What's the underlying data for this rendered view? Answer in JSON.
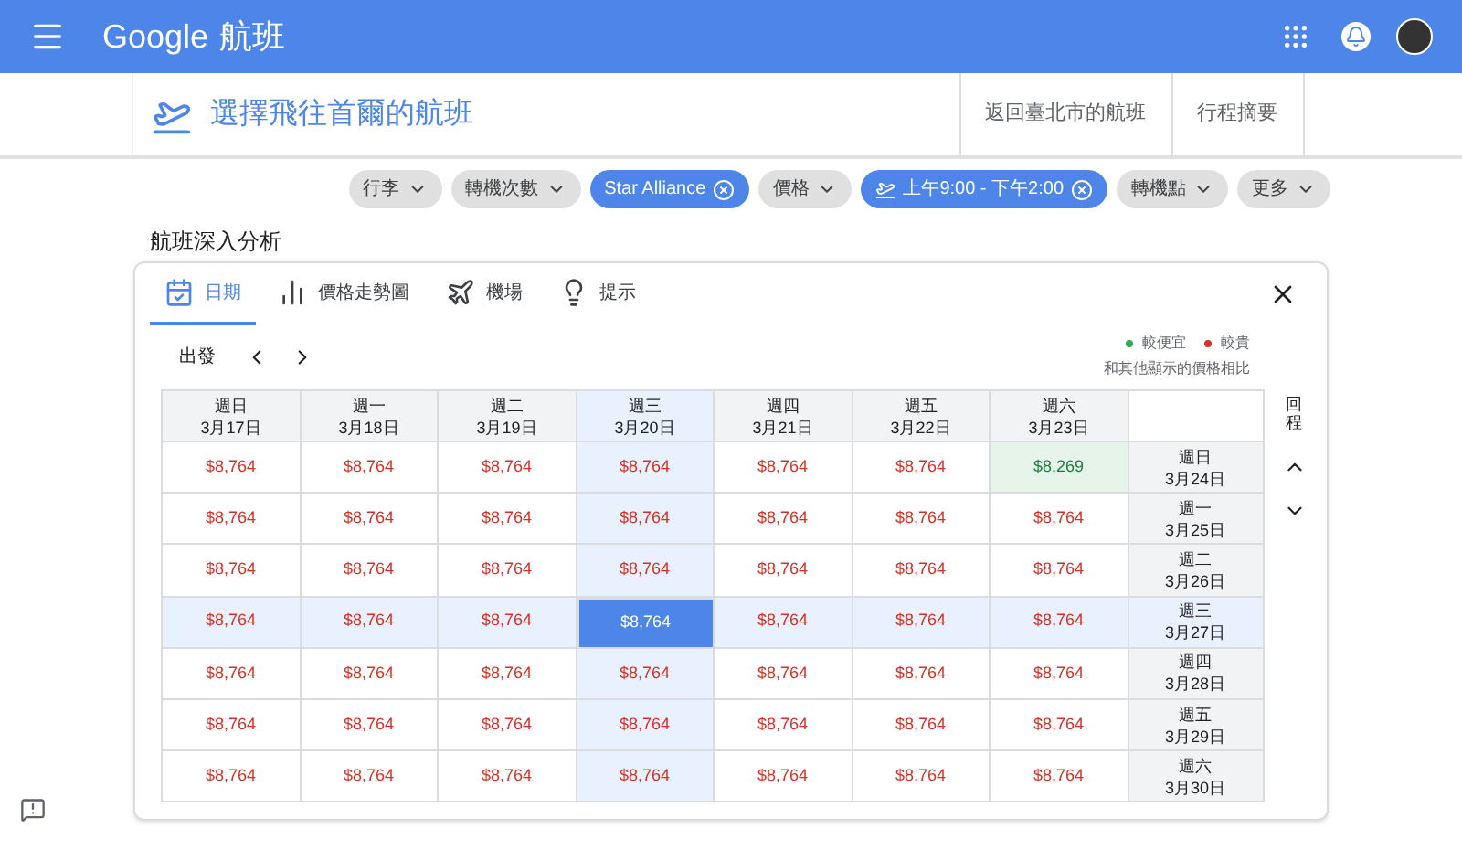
{
  "app_bar": {
    "brand": "Google",
    "product": "航班"
  },
  "trip_header": {
    "title": "選擇飛往首爾的航班",
    "steps": [
      {
        "label": "返回臺北市的航班"
      },
      {
        "label": "行程摘要"
      }
    ]
  },
  "filters": [
    {
      "label": "行李",
      "active": false,
      "kind": "plain"
    },
    {
      "label": "轉機次數",
      "active": false,
      "kind": "plain"
    },
    {
      "label": "Star Alliance",
      "active": true,
      "kind": "plain"
    },
    {
      "label": "價格",
      "active": false,
      "kind": "plain"
    },
    {
      "label": "上午9:00 - 下午2:00",
      "active": true,
      "kind": "takeoff"
    },
    {
      "label": "轉機點",
      "active": false,
      "kind": "plain"
    },
    {
      "label": "更多",
      "active": false,
      "kind": "plain"
    }
  ],
  "section_title": "航班深入分析",
  "tabs": [
    {
      "label": "日期",
      "kind": "calendar",
      "selected": true
    },
    {
      "label": "價格走勢圖",
      "kind": "chart",
      "selected": false
    },
    {
      "label": "機場",
      "kind": "plane",
      "selected": false
    },
    {
      "label": "提示",
      "kind": "bulb",
      "selected": false
    }
  ],
  "date_grid": {
    "departure_label": "出發",
    "return_label": "回程",
    "legend": [
      {
        "label": "較便宜",
        "color": "#34a853"
      },
      {
        "label": "較貴",
        "color": "#d93025"
      }
    ],
    "legend_note": "和其他顯示的價格相比",
    "columns": [
      {
        "day": "週日",
        "date": "3月17日"
      },
      {
        "day": "週一",
        "date": "3月18日"
      },
      {
        "day": "週二",
        "date": "3月19日"
      },
      {
        "day": "週三",
        "date": "3月20日"
      },
      {
        "day": "週四",
        "date": "3月21日"
      },
      {
        "day": "週五",
        "date": "3月22日"
      },
      {
        "day": "週六",
        "date": "3月23日"
      }
    ],
    "rows": [
      {
        "day": "週日",
        "date": "3月24日",
        "cells": [
          {
            "price": "$8,764",
            "kind": "expensive",
            "selected": false
          },
          {
            "price": "$8,764",
            "kind": "expensive",
            "selected": false
          },
          {
            "price": "$8,764",
            "kind": "expensive",
            "selected": false
          },
          {
            "price": "$8,764",
            "kind": "expensive",
            "selected": false
          },
          {
            "price": "$8,764",
            "kind": "expensive",
            "selected": false
          },
          {
            "price": "$8,764",
            "kind": "expensive",
            "selected": false
          },
          {
            "price": "$8,269",
            "kind": "cheaper",
            "selected": false
          }
        ]
      },
      {
        "day": "週一",
        "date": "3月25日",
        "cells": [
          {
            "price": "$8,764",
            "kind": "expensive",
            "selected": false
          },
          {
            "price": "$8,764",
            "kind": "expensive",
            "selected": false
          },
          {
            "price": "$8,764",
            "kind": "expensive",
            "selected": false
          },
          {
            "price": "$8,764",
            "kind": "expensive",
            "selected": false
          },
          {
            "price": "$8,764",
            "kind": "expensive",
            "selected": false
          },
          {
            "price": "$8,764",
            "kind": "expensive",
            "selected": false
          },
          {
            "price": "$8,764",
            "kind": "expensive",
            "selected": false
          }
        ]
      },
      {
        "day": "週二",
        "date": "3月26日",
        "cells": [
          {
            "price": "$8,764",
            "kind": "expensive",
            "selected": false
          },
          {
            "price": "$8,764",
            "kind": "expensive",
            "selected": false
          },
          {
            "price": "$8,764",
            "kind": "expensive",
            "selected": false
          },
          {
            "price": "$8,764",
            "kind": "expensive",
            "selected": false
          },
          {
            "price": "$8,764",
            "kind": "expensive",
            "selected": false
          },
          {
            "price": "$8,764",
            "kind": "expensive",
            "selected": false
          },
          {
            "price": "$8,764",
            "kind": "expensive",
            "selected": false
          }
        ]
      },
      {
        "day": "週三",
        "date": "3月27日",
        "cells": [
          {
            "price": "$8,764",
            "kind": "expensive",
            "selected": false
          },
          {
            "price": "$8,764",
            "kind": "expensive",
            "selected": false
          },
          {
            "price": "$8,764",
            "kind": "expensive",
            "selected": false
          },
          {
            "price": "$8,764",
            "kind": "expensive",
            "selected": true
          },
          {
            "price": "$8,764",
            "kind": "expensive",
            "selected": false
          },
          {
            "price": "$8,764",
            "kind": "expensive",
            "selected": false
          },
          {
            "price": "$8,764",
            "kind": "expensive",
            "selected": false
          }
        ]
      },
      {
        "day": "週四",
        "date": "3月28日",
        "cells": [
          {
            "price": "$8,764",
            "kind": "expensive",
            "selected": false
          },
          {
            "price": "$8,764",
            "kind": "expensive",
            "selected": false
          },
          {
            "price": "$8,764",
            "kind": "expensive",
            "selected": false
          },
          {
            "price": "$8,764",
            "kind": "expensive",
            "selected": false
          },
          {
            "price": "$8,764",
            "kind": "expensive",
            "selected": false
          },
          {
            "price": "$8,764",
            "kind": "expensive",
            "selected": false
          },
          {
            "price": "$8,764",
            "kind": "expensive",
            "selected": false
          }
        ]
      },
      {
        "day": "週五",
        "date": "3月29日",
        "cells": [
          {
            "price": "$8,764",
            "kind": "expensive",
            "selected": false
          },
          {
            "price": "$8,764",
            "kind": "expensive",
            "selected": false
          },
          {
            "price": "$8,764",
            "kind": "expensive",
            "selected": false
          },
          {
            "price": "$8,764",
            "kind": "expensive",
            "selected": false
          },
          {
            "price": "$8,764",
            "kind": "expensive",
            "selected": false
          },
          {
            "price": "$8,764",
            "kind": "expensive",
            "selected": false
          },
          {
            "price": "$8,764",
            "kind": "expensive",
            "selected": false
          }
        ]
      },
      {
        "day": "週六",
        "date": "3月30日",
        "cells": [
          {
            "price": "$8,764",
            "kind": "expensive",
            "selected": false
          },
          {
            "price": "$8,764",
            "kind": "expensive",
            "selected": false
          },
          {
            "price": "$8,764",
            "kind": "expensive",
            "selected": false
          },
          {
            "price": "$8,764",
            "kind": "expensive",
            "selected": false
          },
          {
            "price": "$8,764",
            "kind": "expensive",
            "selected": false
          },
          {
            "price": "$8,764",
            "kind": "expensive",
            "selected": false
          },
          {
            "price": "$8,764",
            "kind": "expensive",
            "selected": false
          }
        ]
      }
    ]
  }
}
